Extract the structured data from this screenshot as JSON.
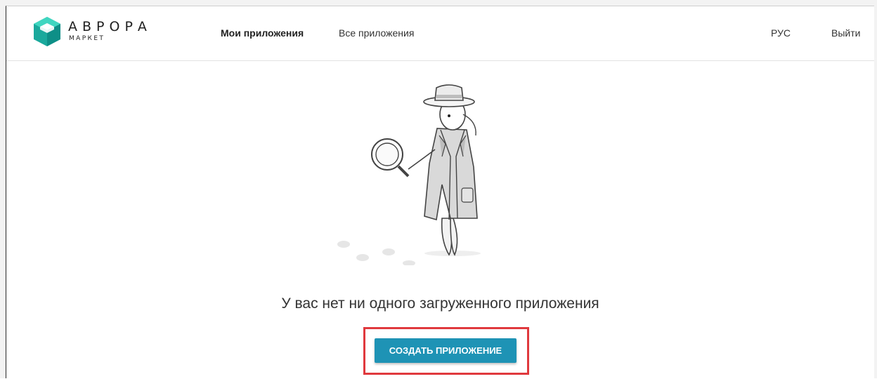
{
  "brand": {
    "name": "АВРОРА",
    "sub": "МАРКЕТ"
  },
  "nav": {
    "my_apps": "Мои приложения",
    "all_apps": "Все приложения",
    "language": "РУС",
    "logout": "Выйти"
  },
  "main": {
    "empty_message": "У вас нет ни одного загруженного приложения",
    "create_button": "СОЗДАТЬ ПРИЛОЖЕНИЕ"
  },
  "icons": {
    "logo": "aurora-cube-logo",
    "illustration": "detective-with-magnifier-illustration"
  },
  "colors": {
    "accent": "#1e93b5",
    "highlight": "#e0393e",
    "logo_top": "#25c8b4",
    "logo_bottom": "#18a49a"
  }
}
